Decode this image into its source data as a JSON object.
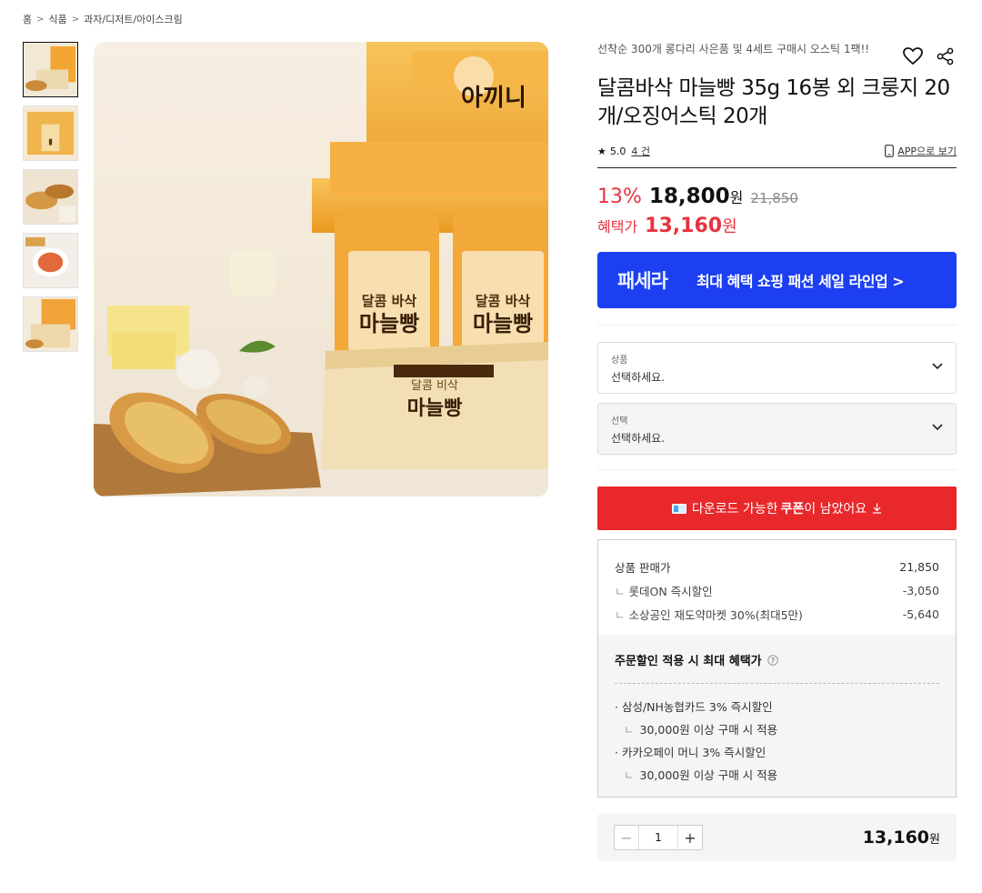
{
  "breadcrumb": {
    "items": [
      "홈",
      "식품",
      "과자/디저트/아이스크림"
    ],
    "separator": ">"
  },
  "gallery": {
    "thumbnail_count": 5,
    "active_index": 0,
    "main_image_text": {
      "brand": "아끼니",
      "box_label_top": "달콤 비삭",
      "box_label_main": "마늘빵",
      "bag_label_top": "달콤 바삭",
      "bag_label_main": "마늘빵"
    }
  },
  "product": {
    "promo_text": "선착순 300개 롱다리 사은품 및 4세트 구매시 오스틱 1팩!!",
    "title": "달콤바삭 마늘빵 35g 16봉 외 크룽지 20개/오징어스틱 20개",
    "rating": "5.0",
    "review_count": "4 건",
    "app_link": "APP으로 보기",
    "discount": "13%",
    "price": "18,800",
    "won": "원",
    "original_price": "21,850",
    "benefit_label": "혜택가",
    "benefit_price": "13,160",
    "benefit_won": "원"
  },
  "banner": {
    "logo": "패세라",
    "text": "최대 혜택 쇼핑 패션 세일 라인업 >",
    "color": "#1c3ff2"
  },
  "options": [
    {
      "label": "상품",
      "value": "선택하세요."
    },
    {
      "label": "선택",
      "value": "선택하세요."
    }
  ],
  "coupon": {
    "prefix": "다운로드 가능한",
    "bold": "쿠폰",
    "suffix": "이 남았어요",
    "color": "#e8282b"
  },
  "price_box": {
    "lines": [
      {
        "label": "상품 판매가",
        "value": "21,850"
      },
      {
        "label": "롯데ON 즉시할인",
        "value": "-3,050"
      },
      {
        "label": "소상공인 재도약마켓 30%(최대5만)",
        "value": "-5,640"
      }
    ],
    "max_benefit_title": "주문할인 적용 시 최대 혜택가",
    "benefits": [
      {
        "text": "· 삼성/NH농협카드 3% 즉시할인",
        "condition": "30,000원 이상 구매 시 적용"
      },
      {
        "text": "· 카카오페이 머니 3% 즉시할인",
        "condition": "30,000원 이상 구매 시 적용"
      }
    ]
  },
  "order": {
    "quantity": "1",
    "minus": "−",
    "plus": "+",
    "total": "13,160",
    "won": "원"
  }
}
